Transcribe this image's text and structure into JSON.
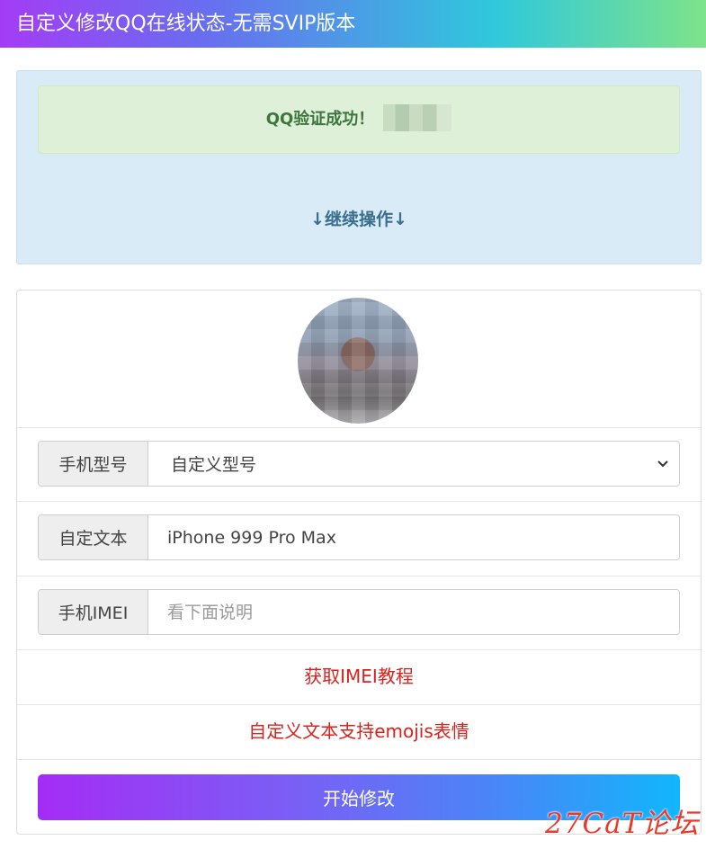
{
  "header": {
    "title": "自定义修改QQ在线状态-无需SVIP版本"
  },
  "verify": {
    "success_text": "QQ验证成功！",
    "continue_text": "↓继续操作↓"
  },
  "form": {
    "model": {
      "label": "手机型号",
      "selected": "自定义型号"
    },
    "custom_text": {
      "label": "自定文本",
      "value": "iPhone 999 Pro Max"
    },
    "imei": {
      "label": "手机IMEI",
      "placeholder": "看下面说明"
    },
    "imei_tutorial_link": "获取IMEI教程",
    "emoji_note": "自定义文本支持emojis表情",
    "submit_label": "开始修改"
  },
  "watermark": "27CaT论坛",
  "colors": {
    "success_text": "#3c763d",
    "link_red": "#d9221c",
    "button_gradient_start": "#a52cf5",
    "button_gradient_end": "#12b6fb"
  }
}
